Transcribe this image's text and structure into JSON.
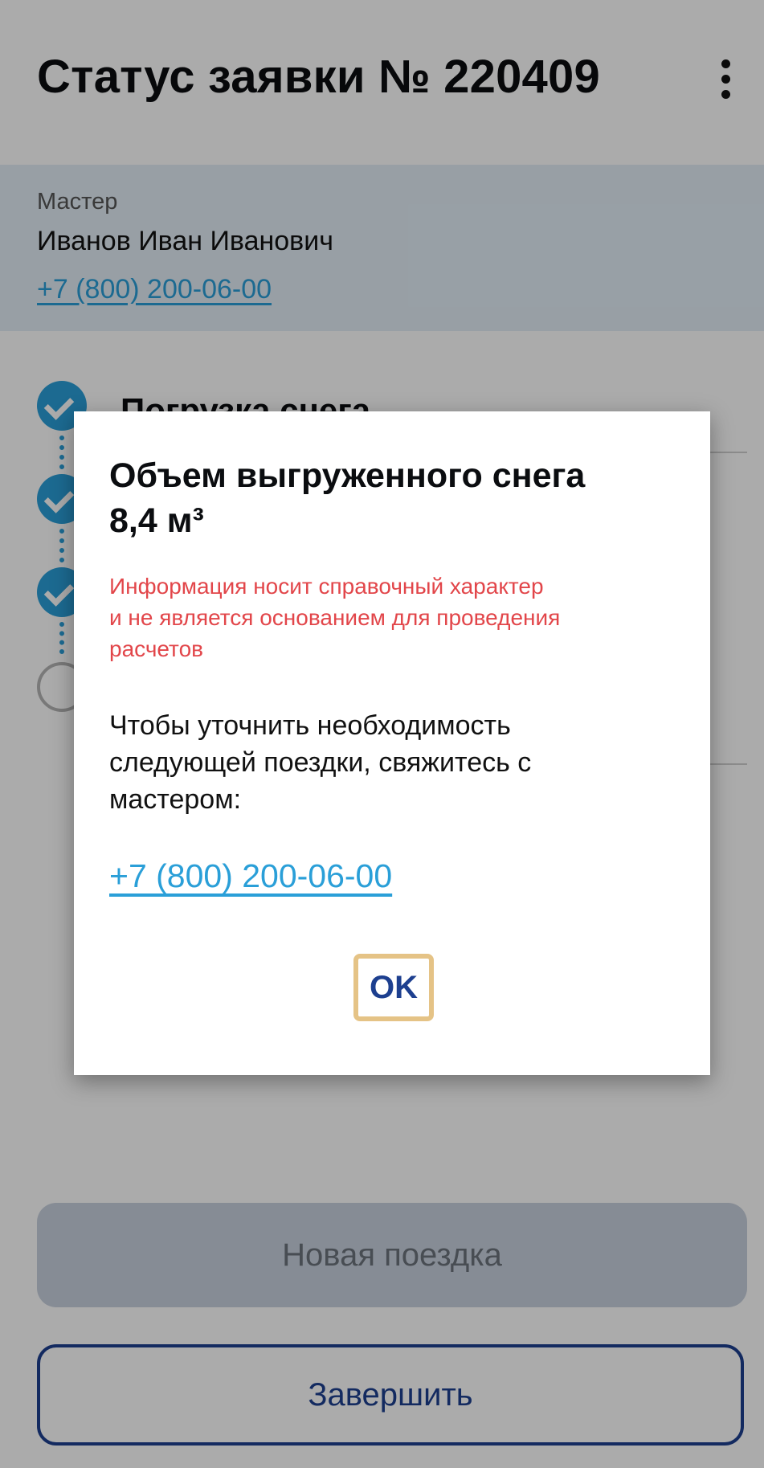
{
  "header": {
    "title": "Статус заявки № 220409",
    "menu_icon": "more-vertical-icon"
  },
  "master": {
    "label": "Мастер",
    "name": "Иванов Иван Иванович",
    "phone": "+7 (800) 200-06-00"
  },
  "steps": {
    "first_title": "Погрузка снега",
    "items": [
      {
        "status": "done",
        "icon": "check-circle-icon"
      },
      {
        "status": "done",
        "icon": "check-circle-icon"
      },
      {
        "status": "done",
        "icon": "check-circle-icon"
      },
      {
        "status": "pending",
        "icon": "empty-circle-icon"
      }
    ]
  },
  "dialog": {
    "title_lines": [
      "Объем выгруженного снега",
      "8,4 м³"
    ],
    "warning_lines": [
      "Информация носит справочный характер",
      "и не является основанием для проведения",
      "расчетов"
    ],
    "text_lines": [
      "Чтобы уточнить необходимость",
      "следующей поездки, свяжитесь с",
      "мастером:"
    ],
    "phone": "+7 (800) 200-06-00",
    "ok_label": "OK"
  },
  "buttons": {
    "new_trip": "Новая поездка",
    "finish": "Завершить"
  },
  "colors": {
    "accent": "#2a9fd8",
    "primary": "#1d3f8f",
    "warning": "#e2464a",
    "master_bg": "#e3eef7",
    "ok_focus": "#e5c386"
  }
}
